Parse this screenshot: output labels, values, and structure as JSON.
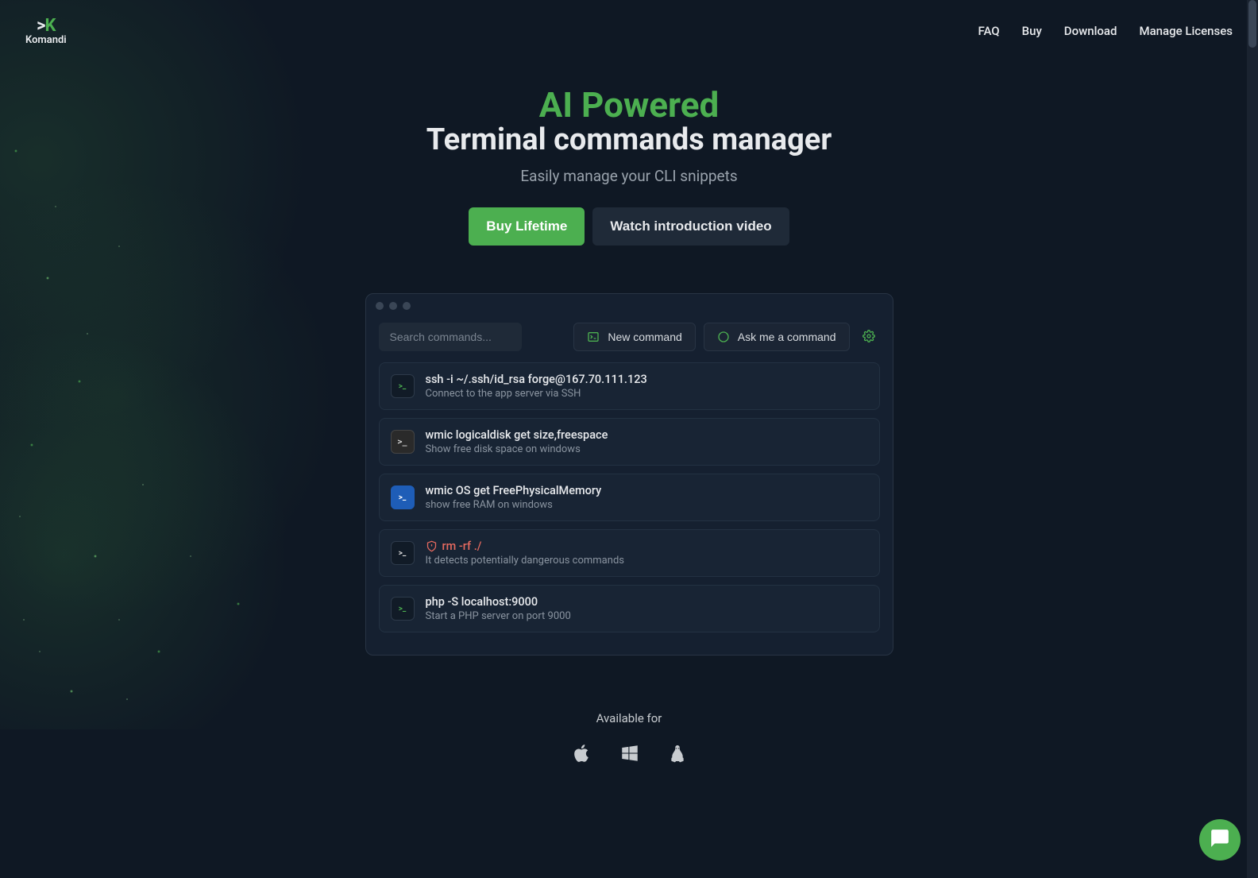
{
  "brand": {
    "mark_prefix": ">",
    "mark_letter": "K",
    "name": "Komandi"
  },
  "nav": {
    "faq": "FAQ",
    "buy": "Buy",
    "download": "Download",
    "manage_licenses": "Manage Licenses"
  },
  "hero": {
    "title_highlight": "AI Powered",
    "title_rest": "Terminal commands manager",
    "tagline": "Easily manage your CLI snippets",
    "buy_button": "Buy Lifetime",
    "watch_button": "Watch introduction video"
  },
  "app": {
    "search_placeholder": "Search commands...",
    "new_command_label": "New command",
    "ask_command_label": "Ask me a command",
    "commands": [
      {
        "icon_type": "terminal-green",
        "title": "ssh -i ~/.ssh/id_rsa forge@167.70.111.123",
        "desc": "Connect to the app server via SSH",
        "danger": false
      },
      {
        "icon_type": "cmd-dark",
        "title": "wmic logicaldisk get size,freespace",
        "desc": "Show free disk space on windows",
        "danger": false
      },
      {
        "icon_type": "powershell",
        "title": "wmic OS get FreePhysicalMemory",
        "desc": "show free RAM on windows",
        "danger": false
      },
      {
        "icon_type": "terminal-dark",
        "title": "rm -rf ./",
        "desc": "It detects potentially dangerous commands",
        "danger": true
      },
      {
        "icon_type": "terminal-green",
        "title": "php -S localhost:9000",
        "desc": "Start a PHP server on port 9000",
        "danger": false
      }
    ]
  },
  "available": {
    "label": "Available for"
  }
}
